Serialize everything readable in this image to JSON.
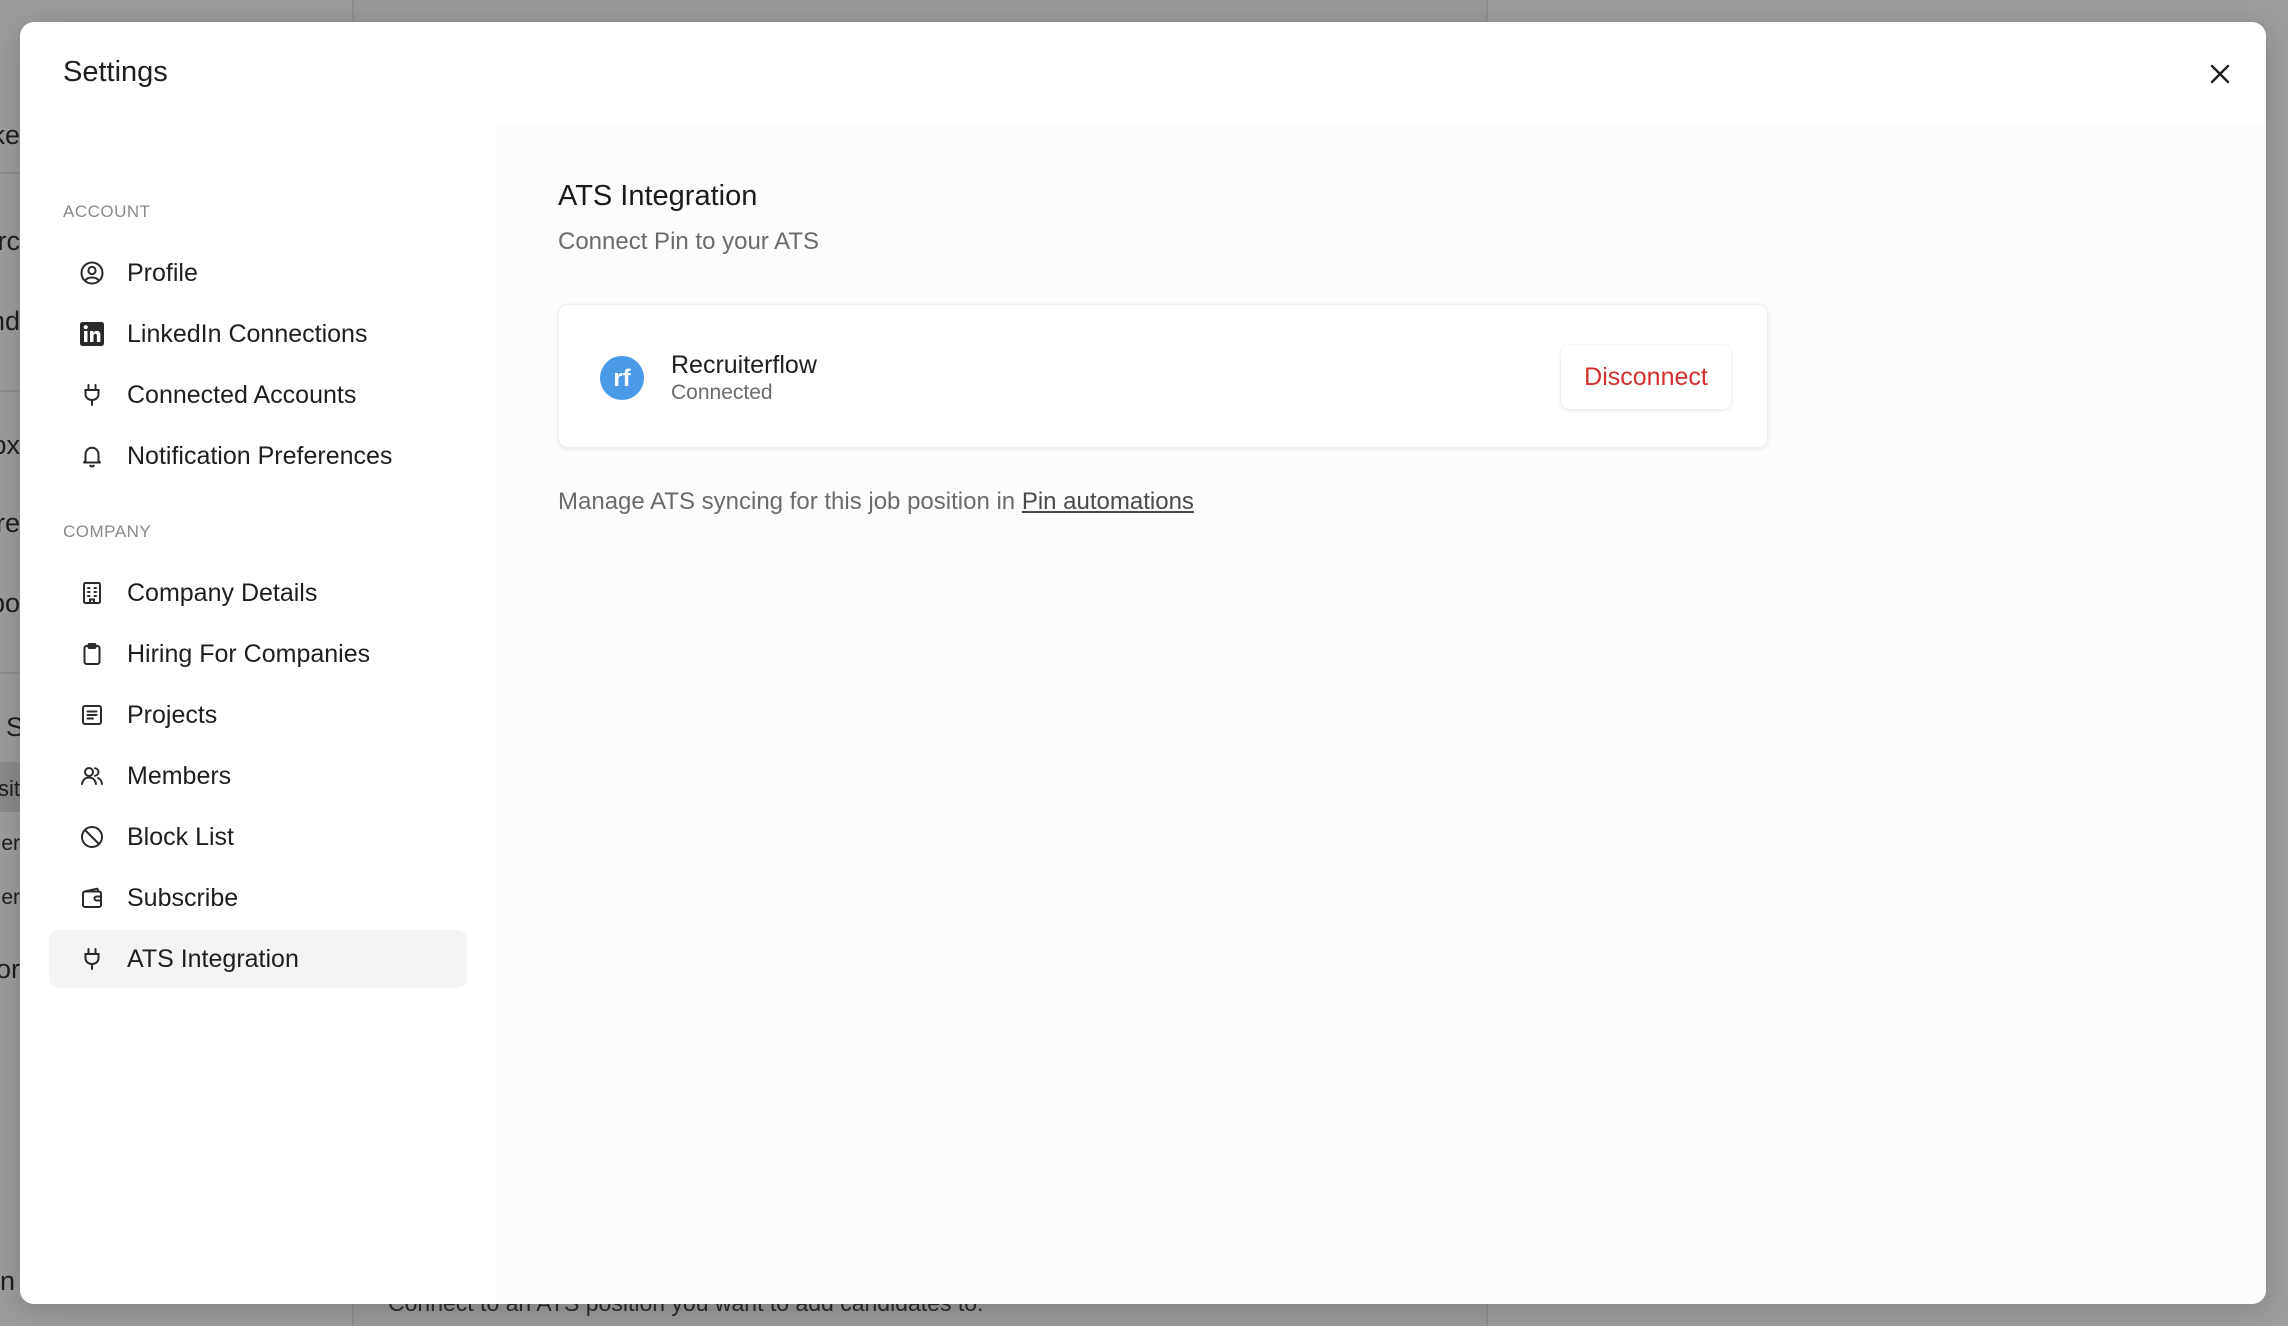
{
  "background": {
    "fragments": [
      "ke",
      "rc",
      "nd",
      "ox",
      "re",
      "bo",
      "S",
      "sit",
      "ler",
      "ier",
      "or",
      "n"
    ],
    "bottom_text": "Connect to an ATS position you want to add candidates to."
  },
  "modal": {
    "title": "Settings",
    "close_icon": "close-icon"
  },
  "nav": {
    "account_label": "ACCOUNT",
    "company_label": "COMPANY",
    "account_items": [
      {
        "label": "Profile",
        "icon": "user-circle-icon"
      },
      {
        "label": "LinkedIn Connections",
        "icon": "linkedin-icon"
      },
      {
        "label": "Connected Accounts",
        "icon": "plug-icon"
      },
      {
        "label": "Notification Preferences",
        "icon": "bell-icon"
      }
    ],
    "company_items": [
      {
        "label": "Company Details",
        "icon": "building-icon"
      },
      {
        "label": "Hiring For Companies",
        "icon": "clipboard-icon"
      },
      {
        "label": "Projects",
        "icon": "list-icon"
      },
      {
        "label": "Members",
        "icon": "users-icon"
      },
      {
        "label": "Block List",
        "icon": "ban-icon"
      },
      {
        "label": "Subscribe",
        "icon": "wallet-icon"
      },
      {
        "label": "ATS Integration",
        "icon": "plug-icon",
        "active": true
      }
    ]
  },
  "content": {
    "title": "ATS Integration",
    "subtitle": "Connect Pin to your ATS",
    "integration": {
      "name": "Recruiterflow",
      "status": "Connected",
      "action_label": "Disconnect",
      "logo": "recruiterflow-logo",
      "logo_text": "rf"
    },
    "manage_prefix": "Manage ATS syncing for this job position in ",
    "manage_link": "Pin automations"
  },
  "colors": {
    "accent_danger": "#d32f2f",
    "logo_blue": "#4a9ae8",
    "active_bg": "#f4f4f4"
  }
}
